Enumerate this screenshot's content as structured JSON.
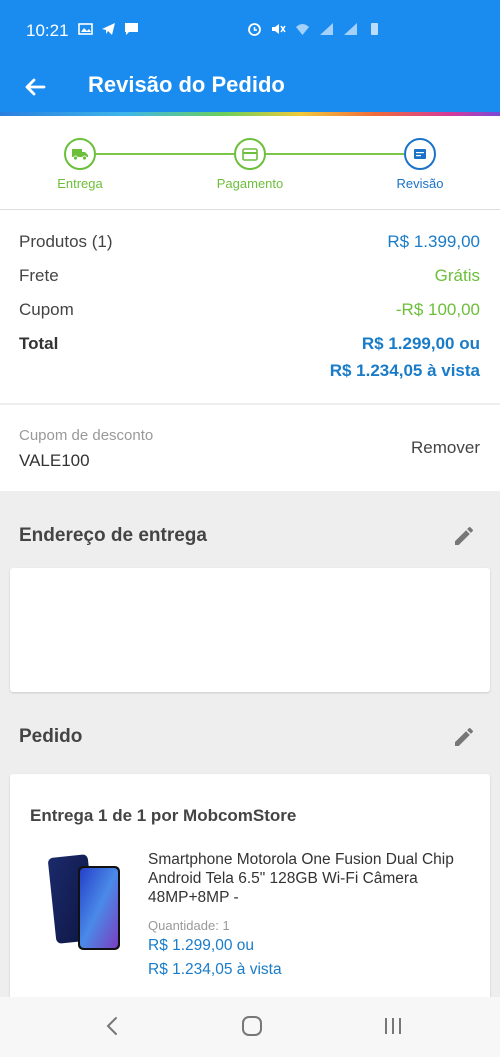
{
  "status_bar": {
    "time": "10:21"
  },
  "app_bar": {
    "title": "Revisão do Pedido"
  },
  "stepper": {
    "steps": [
      {
        "label": "Entrega",
        "state": "done",
        "icon": "truck-icon"
      },
      {
        "label": "Pagamento",
        "state": "done",
        "icon": "card-icon"
      },
      {
        "label": "Revisão",
        "state": "active",
        "icon": "review-icon"
      }
    ]
  },
  "summary": {
    "products_label": "Produtos (1)",
    "products_value": "R$ 1.399,00",
    "shipping_label": "Frete",
    "shipping_value": "Grátis",
    "coupon_label": "Cupom",
    "coupon_value": "-R$ 100,00",
    "total_label": "Total",
    "total_value_1": "R$ 1.299,00 ou",
    "total_value_2": "R$ 1.234,05 à vista"
  },
  "coupon": {
    "label": "Cupom de desconto",
    "code": "VALE100",
    "remove_label": "Remover"
  },
  "address": {
    "title": "Endereço de entrega"
  },
  "order": {
    "title": "Pedido",
    "delivery_title": "Entrega 1 de 1 por MobcomStore",
    "product_name": "Smartphone Motorola One Fusion Dual Chip Android Tela 6.5\" 128GB Wi-Fi Câmera 48MP+8MP -",
    "quantity": "Quantidade:  1",
    "price_1": "R$ 1.299,00 ou",
    "price_2": "R$ 1.234,05 à vista"
  },
  "colors": {
    "primary": "#1a8cf0",
    "green": "#6cbf3a",
    "blue_text": "#1a7cc8"
  }
}
